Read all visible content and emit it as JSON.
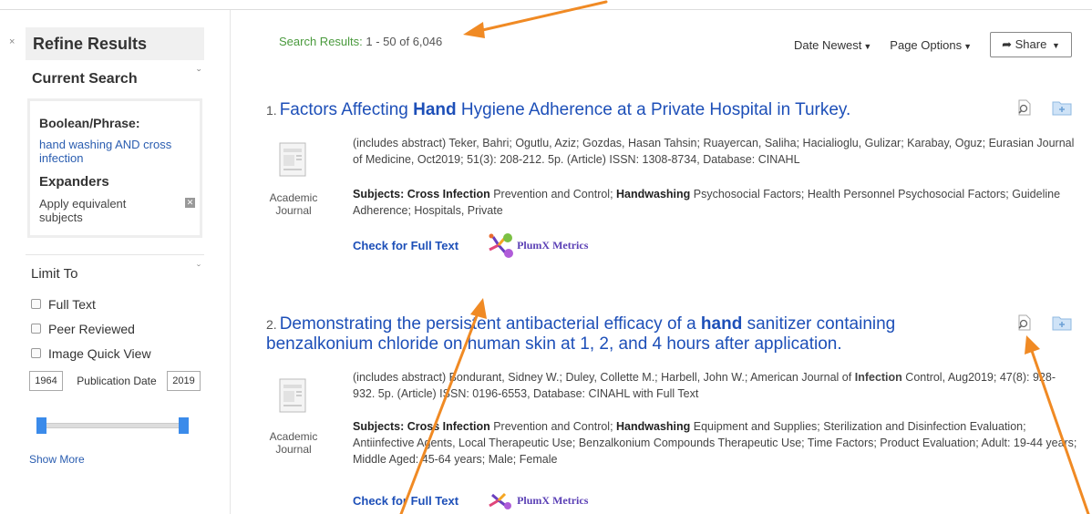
{
  "sidebar": {
    "collapse_label": "×",
    "title": "Refine Results",
    "current_search": {
      "heading": "Current Search",
      "boolean_label": "Boolean/Phrase:",
      "boolean_value": "hand washing AND cross infection",
      "expanders_label": "Expanders",
      "expander_item": "Apply equivalent subjects"
    },
    "limit_to": {
      "heading": "Limit To",
      "options": [
        "Full Text",
        "Peer Reviewed",
        "Image Quick View"
      ],
      "date_from": "1964",
      "date_to": "2019",
      "date_label": "Publication Date",
      "show_more": "Show More"
    }
  },
  "main": {
    "results_label": "Search Results:",
    "results_range": "1 - 50 of 6,046",
    "sort_label": "Date Newest",
    "page_options_label": "Page Options",
    "share_label": "Share"
  },
  "results": [
    {
      "number": "1.",
      "title_parts": [
        "Factors Affecting ",
        "Hand",
        " Hygiene Adherence at a Private Hospital in Turkey."
      ],
      "meta_line": "(includes abstract) Teker, Bahri; Ogutlu, Aziz; Gozdas, Hasan Tahsin; Ruayercan, Saliha; Hacialioglu, Gulizar; Karabay, Oguz; Eurasian Journal of Medicine, Oct2019; 51(3): 208-212. 5p. (Article) ISSN: 1308-8734, Database: CINAHL",
      "doc_type": "Academic Journal",
      "subjects_label": "Subjects:",
      "subjects_parts": [
        " ",
        "Cross Infection",
        " Prevention and Control; ",
        "Handwashing",
        " Psychosocial Factors; Health Personnel Psychosocial Factors; Guideline Adherence; Hospitals, Private"
      ],
      "full_text_link": "Check for Full Text",
      "plumx_label": "PlumX Metrics"
    },
    {
      "number": "2.",
      "title_parts": [
        "Demonstrating the persistent antibacterial efficacy of a ",
        "hand",
        " sanitizer containing benzalkonium chloride on human skin at 1, 2, and 4 hours after application."
      ],
      "meta_parts": [
        "(includes abstract) Bondurant, Sidney W.; Duley, Collette M.; Harbell, John W.; American Journal of ",
        "Infection",
        " Control, Aug2019; 47(8): 928-932. 5p. (Article) ISSN: 0196-6553, Database: CINAHL with Full Text"
      ],
      "doc_type": "Academic Journal",
      "subjects_label": "Subjects:",
      "subjects_parts": [
        " ",
        "Cross Infection",
        " Prevention and Control; ",
        "Handwashing",
        " Equipment and Supplies; Sterilization and Disinfection Evaluation; Antiinfective Agents, Local Therapeutic Use; Benzalkonium Compounds Therapeutic Use; Time Factors; Product Evaluation; Adult: 19-44 years; Middle Aged: 45-64 years; Male; Female"
      ],
      "full_text_link": "Check for Full Text",
      "plumx_label": "PlumX Metrics"
    }
  ],
  "colors": {
    "link_blue": "#1d4fb8",
    "results_label_green": "#4a9a3d",
    "annotation_arrow": "#f08a24",
    "slider_thumb": "#3b8bea"
  },
  "icons": [
    "document-icon",
    "preview-magnifier-icon",
    "add-to-folder-icon",
    "plumx-icon",
    "share-icon",
    "chevron-down-icon",
    "remove-icon"
  ]
}
